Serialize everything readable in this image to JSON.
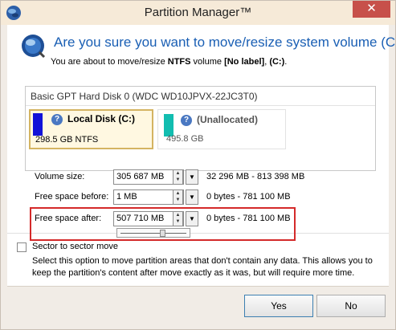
{
  "window": {
    "title": "Partition Manager™",
    "close_glyph": "✕"
  },
  "dialog": {
    "question": "Are you sure you want to move/resize system volume (C:)?",
    "desc_prefix": "You are about to move/resize ",
    "desc_fs": "NTFS",
    "desc_middle": " volume ",
    "desc_label": "[No label]",
    "desc_comma": ", ",
    "desc_drive": "(C:)",
    "desc_end": "."
  },
  "disk": {
    "title": "Basic GPT Hard Disk 0 (WDC WD10JPVX-22JC3T0)",
    "partitions": [
      {
        "name": "Local Disk (C:)",
        "size": "298.5 GB NTFS",
        "color": "#1212d8",
        "help": "?"
      },
      {
        "name": "(Unallocated)",
        "size": "495.8 GB",
        "color": "#12bdb0",
        "help": "?"
      }
    ]
  },
  "fields": [
    {
      "label": "Volume size:",
      "value": "305 687 MB",
      "range": "32 296 MB - 813 398 MB"
    },
    {
      "label": "Free space before:",
      "value": "1 MB",
      "range": "0 bytes - 781 100 MB"
    },
    {
      "label": "Free space after:",
      "value": "507 710 MB",
      "range": "0 bytes - 781 100 MB"
    }
  ],
  "slider": {
    "fraction": 0.65
  },
  "option": {
    "label": "Sector to sector move",
    "checked": false,
    "description": "Select this option to move partition areas that don't contain any data. This allows you to keep the partition's content after move exactly as it was, but will require more time."
  },
  "buttons": {
    "yes": "Yes",
    "no": "No"
  },
  "icons": {
    "app": "globe-icon",
    "spin_up": "▲",
    "spin_down": "▼",
    "dropdown": "▼"
  }
}
